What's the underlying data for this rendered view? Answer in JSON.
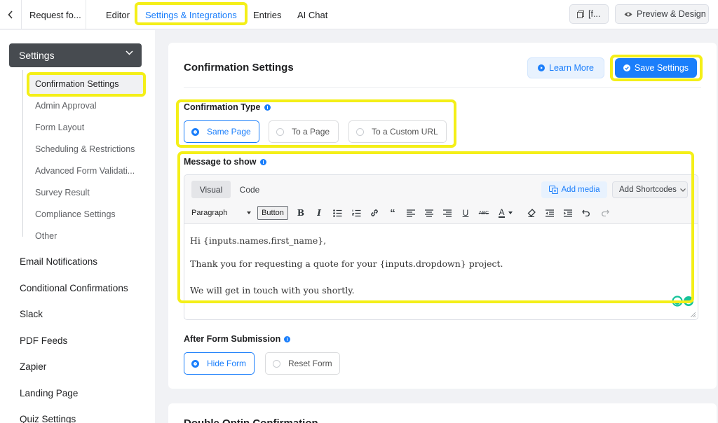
{
  "topbar": {
    "form_title": "Request fo...",
    "tabs": [
      {
        "label": "Editor"
      },
      {
        "label": "Settings & Integrations"
      },
      {
        "label": "Entries"
      },
      {
        "label": "AI Chat"
      }
    ],
    "shortcode_btn": "[f...",
    "preview_btn": "Preview & Design"
  },
  "sidebar": {
    "settings_label": "Settings",
    "sub_items": [
      {
        "label": "Confirmation Settings"
      },
      {
        "label": "Admin Approval"
      },
      {
        "label": "Form Layout"
      },
      {
        "label": "Scheduling & Restrictions"
      },
      {
        "label": "Advanced Form Validati..."
      },
      {
        "label": "Survey Result"
      },
      {
        "label": "Compliance Settings"
      },
      {
        "label": "Other"
      }
    ],
    "items": [
      {
        "label": "Email Notifications"
      },
      {
        "label": "Conditional Confirmations"
      },
      {
        "label": "Slack"
      },
      {
        "label": "PDF Feeds"
      },
      {
        "label": "Zapier"
      },
      {
        "label": "Landing Page"
      },
      {
        "label": "Quiz Settings"
      }
    ]
  },
  "main": {
    "title": "Confirmation Settings",
    "learn_more": "Learn More",
    "save": "Save Settings",
    "confirmation_type": {
      "label": "Confirmation Type",
      "options": [
        "Same Page",
        "To a Page",
        "To a Custom URL"
      ],
      "selected": "Same Page"
    },
    "message": {
      "label": "Message to show",
      "tab_visual": "Visual",
      "tab_code": "Code",
      "add_media": "Add media",
      "add_shortcodes": "Add Shortcodes",
      "paragraph": "Paragraph",
      "button": "Button",
      "lines": [
        "Hi {inputs.names.first_name},",
        "Thank you for requesting a quote for your {inputs.dropdown} project.",
        "We will get in touch with you shortly."
      ]
    },
    "after_submission": {
      "label": "After Form Submission",
      "options": [
        "Hide Form",
        "Reset Form"
      ],
      "selected": "Hide Form"
    },
    "next_section_title": "Double Optin Confirmation"
  },
  "colors": {
    "accent": "#1a7efb",
    "highlight": "#f4ef18",
    "sidebar_head": "#474b50"
  }
}
